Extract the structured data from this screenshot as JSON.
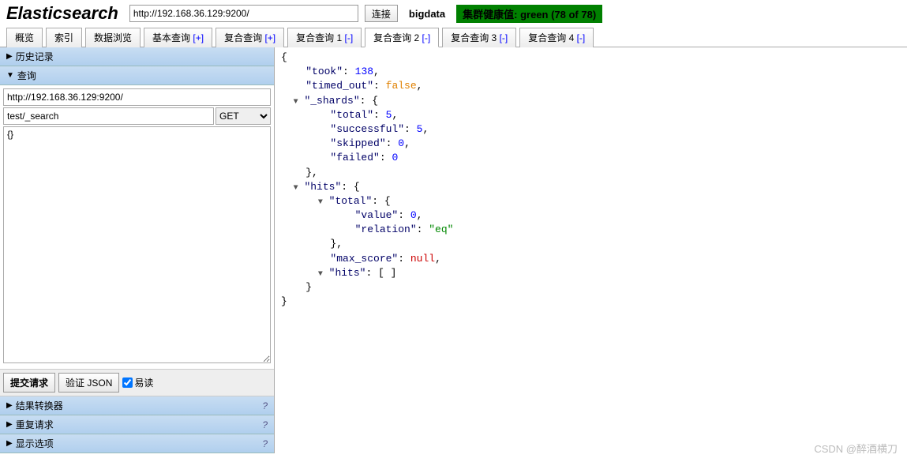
{
  "header": {
    "logo": "Elasticsearch",
    "url": "http://192.168.36.129:9200/",
    "connect_label": "连接",
    "cluster_name": "bigdata",
    "health_text": "集群健康值: green (78 of 78)"
  },
  "tabs": {
    "items": [
      {
        "label": "概览",
        "suffix": ""
      },
      {
        "label": "索引",
        "suffix": ""
      },
      {
        "label": "数据浏览",
        "suffix": ""
      },
      {
        "label": "基本查询",
        "suffix": "[+]"
      },
      {
        "label": "复合查询",
        "suffix": "[+]"
      },
      {
        "label": "复合查询 1",
        "suffix": "[-]"
      },
      {
        "label": "复合查询 2",
        "suffix": "[-]"
      },
      {
        "label": "复合查询 3",
        "suffix": "[-]"
      },
      {
        "label": "复合查询 4",
        "suffix": "[-]"
      }
    ],
    "active_index": 6
  },
  "sidebar": {
    "history": {
      "label": "历史记录",
      "expanded": false
    },
    "query": {
      "label": "查询",
      "expanded": true,
      "endpoint": "http://192.168.36.129:9200/",
      "path": "test/_search",
      "method": "GET",
      "body": "{}"
    },
    "buttons": {
      "submit": "提交请求",
      "validate": "验证 JSON",
      "pretty_label": "易读",
      "pretty_checked": true
    },
    "transformer": {
      "label": "结果转换器",
      "help": "?"
    },
    "repeat": {
      "label": "重复请求",
      "help": "?"
    },
    "display": {
      "label": "显示选项",
      "help": "?"
    }
  },
  "result": {
    "took": 138,
    "timed_out": false,
    "_shards": {
      "total": 5,
      "successful": 5,
      "skipped": 0,
      "failed": 0
    },
    "hits": {
      "total": {
        "value": 0,
        "relation": "eq"
      },
      "max_score": null,
      "hits": []
    }
  },
  "watermark": "CSDN @醉酒横刀"
}
